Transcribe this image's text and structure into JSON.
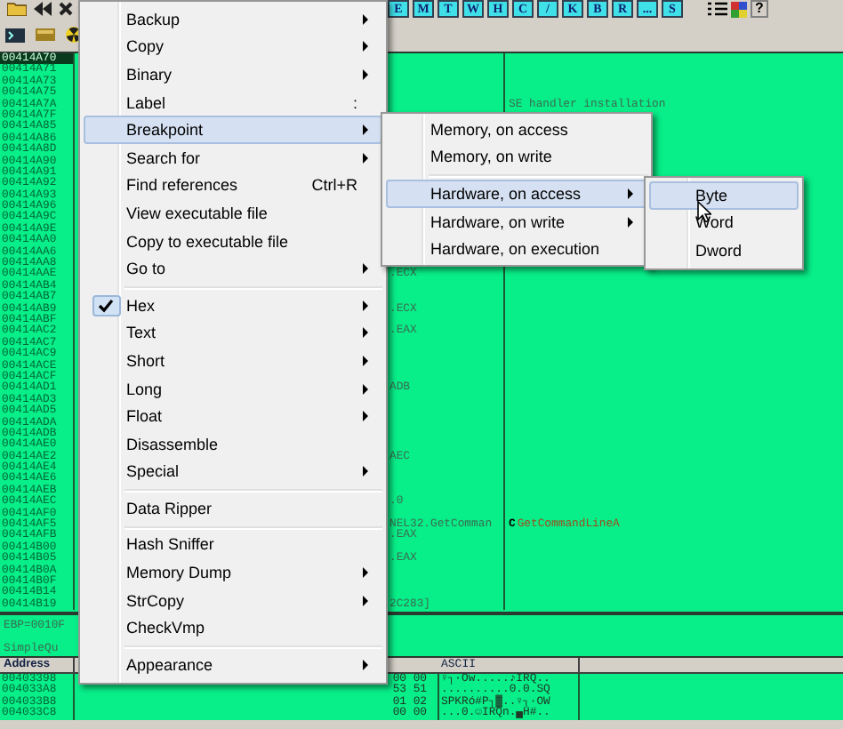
{
  "toolbar": {
    "letter_buttons": [
      "E",
      "M",
      "T",
      "W",
      "H",
      "C",
      "/",
      "K",
      "B",
      "R",
      "...",
      "S"
    ],
    "help_button": "?"
  },
  "cpu": {
    "rows": [
      {
        "address": "00414A70",
        "selected": true
      },
      {
        "address": "00414A71",
        "selected": false
      },
      {
        "address": "00414A73",
        "selected": false
      },
      {
        "address": "00414A75",
        "selected": false
      },
      {
        "address": "00414A7A",
        "selected": false,
        "comment": "SE handler installation"
      },
      {
        "address": "00414A7F",
        "selected": false
      },
      {
        "address": "00414A85",
        "selected": false
      },
      {
        "address": "00414A86",
        "selected": false
      },
      {
        "address": "00414A8D",
        "selected": false
      },
      {
        "address": "00414A90",
        "selected": false
      },
      {
        "address": "00414A91",
        "selected": false
      },
      {
        "address": "00414A92",
        "selected": false
      },
      {
        "address": "00414A93",
        "selected": false
      },
      {
        "address": "00414A96",
        "selected": false
      },
      {
        "address": "00414A9C",
        "selected": false
      },
      {
        "address": "00414A9E",
        "selected": false
      },
      {
        "address": "00414AA0",
        "selected": false
      },
      {
        "address": "00414AA6",
        "selected": false
      },
      {
        "address": "00414AA8",
        "selected": false
      },
      {
        "address": "00414AAE",
        "selected": false,
        "code": ".ECX"
      },
      {
        "address": "00414AB4",
        "selected": false
      },
      {
        "address": "00414AB7",
        "selected": false
      },
      {
        "address": "00414AB9",
        "selected": false,
        "code": ".ECX"
      },
      {
        "address": "00414ABF",
        "selected": false
      },
      {
        "address": "00414AC2",
        "selected": false,
        "code": ".EAX"
      },
      {
        "address": "00414AC7",
        "selected": false
      },
      {
        "address": "00414AC9",
        "selected": false
      },
      {
        "address": "00414ACE",
        "selected": false
      },
      {
        "address": "00414ACF",
        "selected": false
      },
      {
        "address": "00414AD1",
        "selected": false,
        "code": "ADB"
      },
      {
        "address": "00414AD3",
        "selected": false
      },
      {
        "address": "00414AD5",
        "selected": false
      },
      {
        "address": "00414ADA",
        "selected": false
      },
      {
        "address": "00414ADB",
        "selected": false
      },
      {
        "address": "00414AE0",
        "selected": false
      },
      {
        "address": "00414AE2",
        "selected": false,
        "code": "AEC"
      },
      {
        "address": "00414AE4",
        "selected": false
      },
      {
        "address": "00414AE6",
        "selected": false
      },
      {
        "address": "00414AEB",
        "selected": false
      },
      {
        "address": "00414AEC",
        "selected": false,
        "code": ".0"
      },
      {
        "address": "00414AF0",
        "selected": false
      },
      {
        "address": "00414AF5",
        "selected": false,
        "code": "NEL32.GetComman",
        "marker": "C",
        "comment": "GetCommandLineA"
      },
      {
        "address": "00414AFB",
        "selected": false,
        "code": ".EAX"
      },
      {
        "address": "00414B00",
        "selected": false
      },
      {
        "address": "00414B05",
        "selected": false,
        "code": ".EAX"
      },
      {
        "address": "00414B0A",
        "selected": false
      },
      {
        "address": "00414B0F",
        "selected": false
      },
      {
        "address": "00414B14",
        "selected": false
      },
      {
        "address": "00414B19",
        "selected": false,
        "code": "2C283]"
      }
    ]
  },
  "registers": {
    "lines": [
      "EBP=0010F",
      "SimpleQu"
    ]
  },
  "dump": {
    "columns": [
      "Address",
      "ASCII"
    ],
    "rows": [
      {
        "address": "00403398",
        "hex": "00 00",
        "ascii": "♀┐·Ow.....♪IRQ.."
      },
      {
        "address": "004033A8",
        "hex": "53 51",
        "ascii": "..........0.0.SQ"
      },
      {
        "address": "004033B8",
        "hex": "01 02",
        "ascii": "SPKRó#P┐▓..♀┐·OW"
      },
      {
        "address": "004033C8",
        "hex": "00 00",
        "ascii": "...0.☺IRQn.▄H#.."
      }
    ]
  },
  "context_menu": {
    "items": [
      {
        "kind": "item",
        "label": "Backup",
        "submenu": true,
        "checked": false,
        "selected": false
      },
      {
        "kind": "item",
        "label": "Copy",
        "submenu": true,
        "checked": false,
        "selected": false
      },
      {
        "kind": "item",
        "label": "Binary",
        "submenu": true,
        "checked": false,
        "selected": false
      },
      {
        "kind": "item",
        "label": "Label",
        "shortcut": ":",
        "submenu": false,
        "checked": false,
        "selected": false
      },
      {
        "kind": "item",
        "label": "Breakpoint",
        "submenu": true,
        "checked": false,
        "selected": true
      },
      {
        "kind": "item",
        "label": "Search for",
        "submenu": true,
        "checked": false,
        "selected": false
      },
      {
        "kind": "item",
        "label": "Find references",
        "shortcut": "Ctrl+R",
        "submenu": false,
        "checked": false,
        "selected": false
      },
      {
        "kind": "item",
        "label": "View executable file",
        "submenu": false,
        "checked": false,
        "selected": false
      },
      {
        "kind": "item",
        "label": "Copy to executable file",
        "submenu": false,
        "checked": false,
        "selected": false
      },
      {
        "kind": "item",
        "label": "Go to",
        "submenu": true,
        "checked": false,
        "selected": false
      },
      {
        "kind": "separator"
      },
      {
        "kind": "item",
        "label": "Hex",
        "submenu": true,
        "checked": true,
        "selected": false
      },
      {
        "kind": "item",
        "label": "Text",
        "submenu": true,
        "checked": false,
        "selected": false
      },
      {
        "kind": "item",
        "label": "Short",
        "submenu": true,
        "checked": false,
        "selected": false
      },
      {
        "kind": "item",
        "label": "Long",
        "submenu": true,
        "checked": false,
        "selected": false
      },
      {
        "kind": "item",
        "label": "Float",
        "submenu": true,
        "checked": false,
        "selected": false
      },
      {
        "kind": "item",
        "label": "Disassemble",
        "submenu": false,
        "checked": false,
        "selected": false
      },
      {
        "kind": "item",
        "label": "Special",
        "submenu": true,
        "checked": false,
        "selected": false
      },
      {
        "kind": "separator"
      },
      {
        "kind": "item",
        "label": "Data Ripper",
        "submenu": false,
        "checked": false,
        "selected": false
      },
      {
        "kind": "separator"
      },
      {
        "kind": "item",
        "label": "Hash Sniffer",
        "submenu": false,
        "checked": false,
        "selected": false
      },
      {
        "kind": "item",
        "label": "Memory Dump",
        "submenu": true,
        "checked": false,
        "selected": false
      },
      {
        "kind": "item",
        "label": "StrCopy",
        "submenu": true,
        "checked": false,
        "selected": false
      },
      {
        "kind": "item",
        "label": "CheckVmp",
        "submenu": false,
        "checked": false,
        "selected": false
      },
      {
        "kind": "separator"
      },
      {
        "kind": "item",
        "label": "Appearance",
        "submenu": true,
        "checked": false,
        "selected": false
      }
    ]
  },
  "breakpoint_submenu": {
    "items": [
      {
        "kind": "item",
        "label": "Memory, on access",
        "submenu": false,
        "checked": false,
        "selected": false
      },
      {
        "kind": "item",
        "label": "Memory, on write",
        "submenu": false,
        "checked": false,
        "selected": false
      },
      {
        "kind": "separator"
      },
      {
        "kind": "item",
        "label": "Hardware, on access",
        "submenu": true,
        "checked": false,
        "selected": true
      },
      {
        "kind": "item",
        "label": "Hardware, on write",
        "submenu": true,
        "checked": false,
        "selected": false
      },
      {
        "kind": "item",
        "label": "Hardware, on execution",
        "submenu": false,
        "checked": false,
        "selected": false
      }
    ]
  },
  "hardware_access_submenu": {
    "items": [
      {
        "kind": "item",
        "label": "Byte",
        "submenu": false,
        "checked": false,
        "selected": true
      },
      {
        "kind": "item",
        "label": "Word",
        "submenu": false,
        "checked": false,
        "selected": false
      },
      {
        "kind": "item",
        "label": "Dword",
        "submenu": false,
        "checked": false,
        "selected": false
      }
    ]
  }
}
